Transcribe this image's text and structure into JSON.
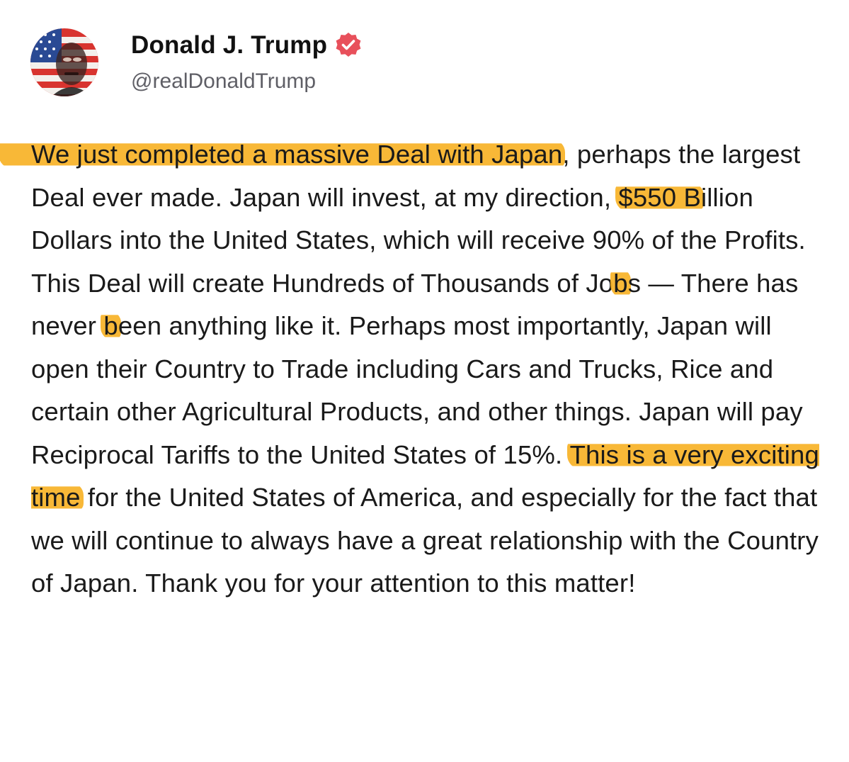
{
  "author": {
    "display_name": "Donald J. Trump",
    "handle": "@realDonaldTrump",
    "avatar_icon": "flag-portrait-avatar",
    "verified_icon": "verified-badge-icon",
    "verified_color": "#e8505b"
  },
  "highlight_color": "#f7b226",
  "post": {
    "segments": [
      {
        "text": "We just completed a massive Deal with Japan",
        "highlight": true
      },
      {
        "text": ", perhaps the largest Deal ever made. Japan will invest, at my direction, ",
        "highlight": false
      },
      {
        "text": "$550 B",
        "highlight": true
      },
      {
        "text": "illion Dollars into the United States, which will receive 90% of the Profits. This Deal will create Hundreds of Thousands of Jo",
        "highlight": false
      },
      {
        "text": "b",
        "highlight": true
      },
      {
        "text": "s — There has never ",
        "highlight": false
      },
      {
        "text": "b",
        "highlight": true
      },
      {
        "text": "een anything like it. Perhaps most importantly, Japan will open their Country to Trade including Cars and Trucks, Rice and certain other Agricultural Products, and other things. Japan will pay Reciprocal Tariffs to the United States of 15%. ",
        "highlight": false
      },
      {
        "text": "This is a very exciting time",
        "highlight": true
      },
      {
        "text": " for the United States of America, and especially for the fact that we will continue to always have a great relationship with the Country of Japan. Thank you for your attention to this matter!",
        "highlight": false
      }
    ]
  }
}
